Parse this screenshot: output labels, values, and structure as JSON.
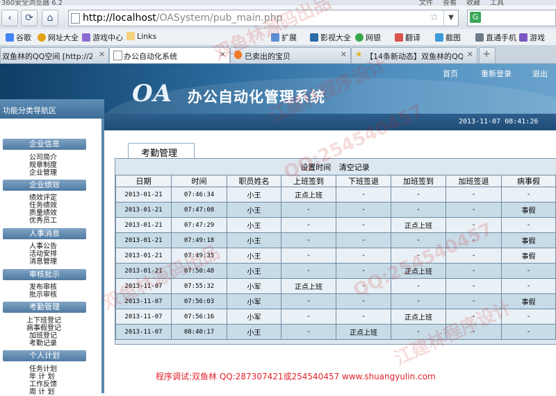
{
  "browser": {
    "title": "360安全浏览器 6.2",
    "menu": [
      "文件",
      "查看",
      "收藏",
      "工具"
    ],
    "url_host": "http://localhost",
    "url_path": "/OASystem/pub_main.php",
    "bookmarks": [
      "谷歌",
      "网址大全",
      "游戏中心",
      "Links",
      "扩展",
      "影视大全",
      "网银",
      "翻译",
      "截图",
      "直通手机",
      "游戏"
    ],
    "tabs": [
      {
        "label": "双鱼林的QQ空间 [http://287"
      },
      {
        "label": "办公自动化系统"
      },
      {
        "label": "已卖出的宝贝"
      },
      {
        "label": "【14条新动态】双鱼林的QQ空"
      }
    ]
  },
  "header": {
    "logo": "OA",
    "system_title": "办公自动化管理系统",
    "links": [
      "首页",
      "重新登录",
      "退出"
    ],
    "datetime": "2013-11-07 08:41:26",
    "nav_caption": "功能分类导航区"
  },
  "sidebar": {
    "sections": [
      {
        "title": "企业信息",
        "items": [
          "公司简介",
          "规章制度",
          "企业管理"
        ]
      },
      {
        "title": "企业绩效",
        "items": [
          "绩效评定",
          "任务绩效",
          "质量绩效",
          "优秀员工"
        ]
      },
      {
        "title": "人事消息",
        "items": [
          "人事公告",
          "活动安排",
          "消息管理"
        ]
      },
      {
        "title": "审核批示",
        "items": [
          "发布审核",
          "批示审核"
        ]
      },
      {
        "title": "考勤管理",
        "items": [
          "上下班登记",
          "病事假登记",
          "加班登记",
          "考勤记录"
        ]
      },
      {
        "title": "个人计划",
        "items": [
          "任务计划",
          "年 计 划",
          "工作反馈",
          "周 计 划"
        ]
      }
    ]
  },
  "main": {
    "tab": "考勤管理",
    "actions": [
      "设置时间",
      "清空记录"
    ],
    "columns": [
      "日期",
      "时间",
      "职员姓名",
      "上班签到",
      "下班签退",
      "加班签到",
      "加班签退",
      "病事假"
    ],
    "rows": [
      [
        "2013-01-21",
        "07:46:34",
        "小王",
        "正点上班",
        "-",
        "-",
        "-",
        "-"
      ],
      [
        "2013-01-21",
        "07:47:08",
        "小王",
        "-",
        "-",
        "-",
        "-",
        "事假"
      ],
      [
        "2013-01-21",
        "07:47:29",
        "小王",
        "-",
        "-",
        "正点上班",
        "-",
        "-"
      ],
      [
        "2013-01-21",
        "07:49:18",
        "小王",
        "-",
        "-",
        "-",
        "-",
        "事假"
      ],
      [
        "2013-01-21",
        "07:49:35",
        "小王",
        "-",
        "-",
        "-",
        "-",
        "事假"
      ],
      [
        "2013-01-21",
        "07:50:48",
        "小王",
        "-",
        "-",
        "正点上班",
        "-",
        "-"
      ],
      [
        "2013-11-07",
        "07:55:32",
        "小军",
        "正点上班",
        "-",
        "-",
        "-",
        "-"
      ],
      [
        "2013-11-07",
        "07:56:03",
        "小军",
        "-",
        "-",
        "-",
        "-",
        "事假"
      ],
      [
        "2013-11-07",
        "07:56:16",
        "小军",
        "-",
        "-",
        "正点上班",
        "-",
        "-"
      ],
      [
        "2013-11-07",
        "08:40:17",
        "小王",
        "-",
        "正点上班",
        "-",
        "-",
        "-"
      ]
    ]
  },
  "footer": "程序调试:双鱼林 QQ:287307421或254540457 www.shuangyulin.com",
  "watermarks": [
    "双鱼林源码出品",
    "江建林程序设计",
    "QQ:254540457",
    "双鱼林源码出品",
    "QQ:254540457",
    "江建林程序设计"
  ]
}
